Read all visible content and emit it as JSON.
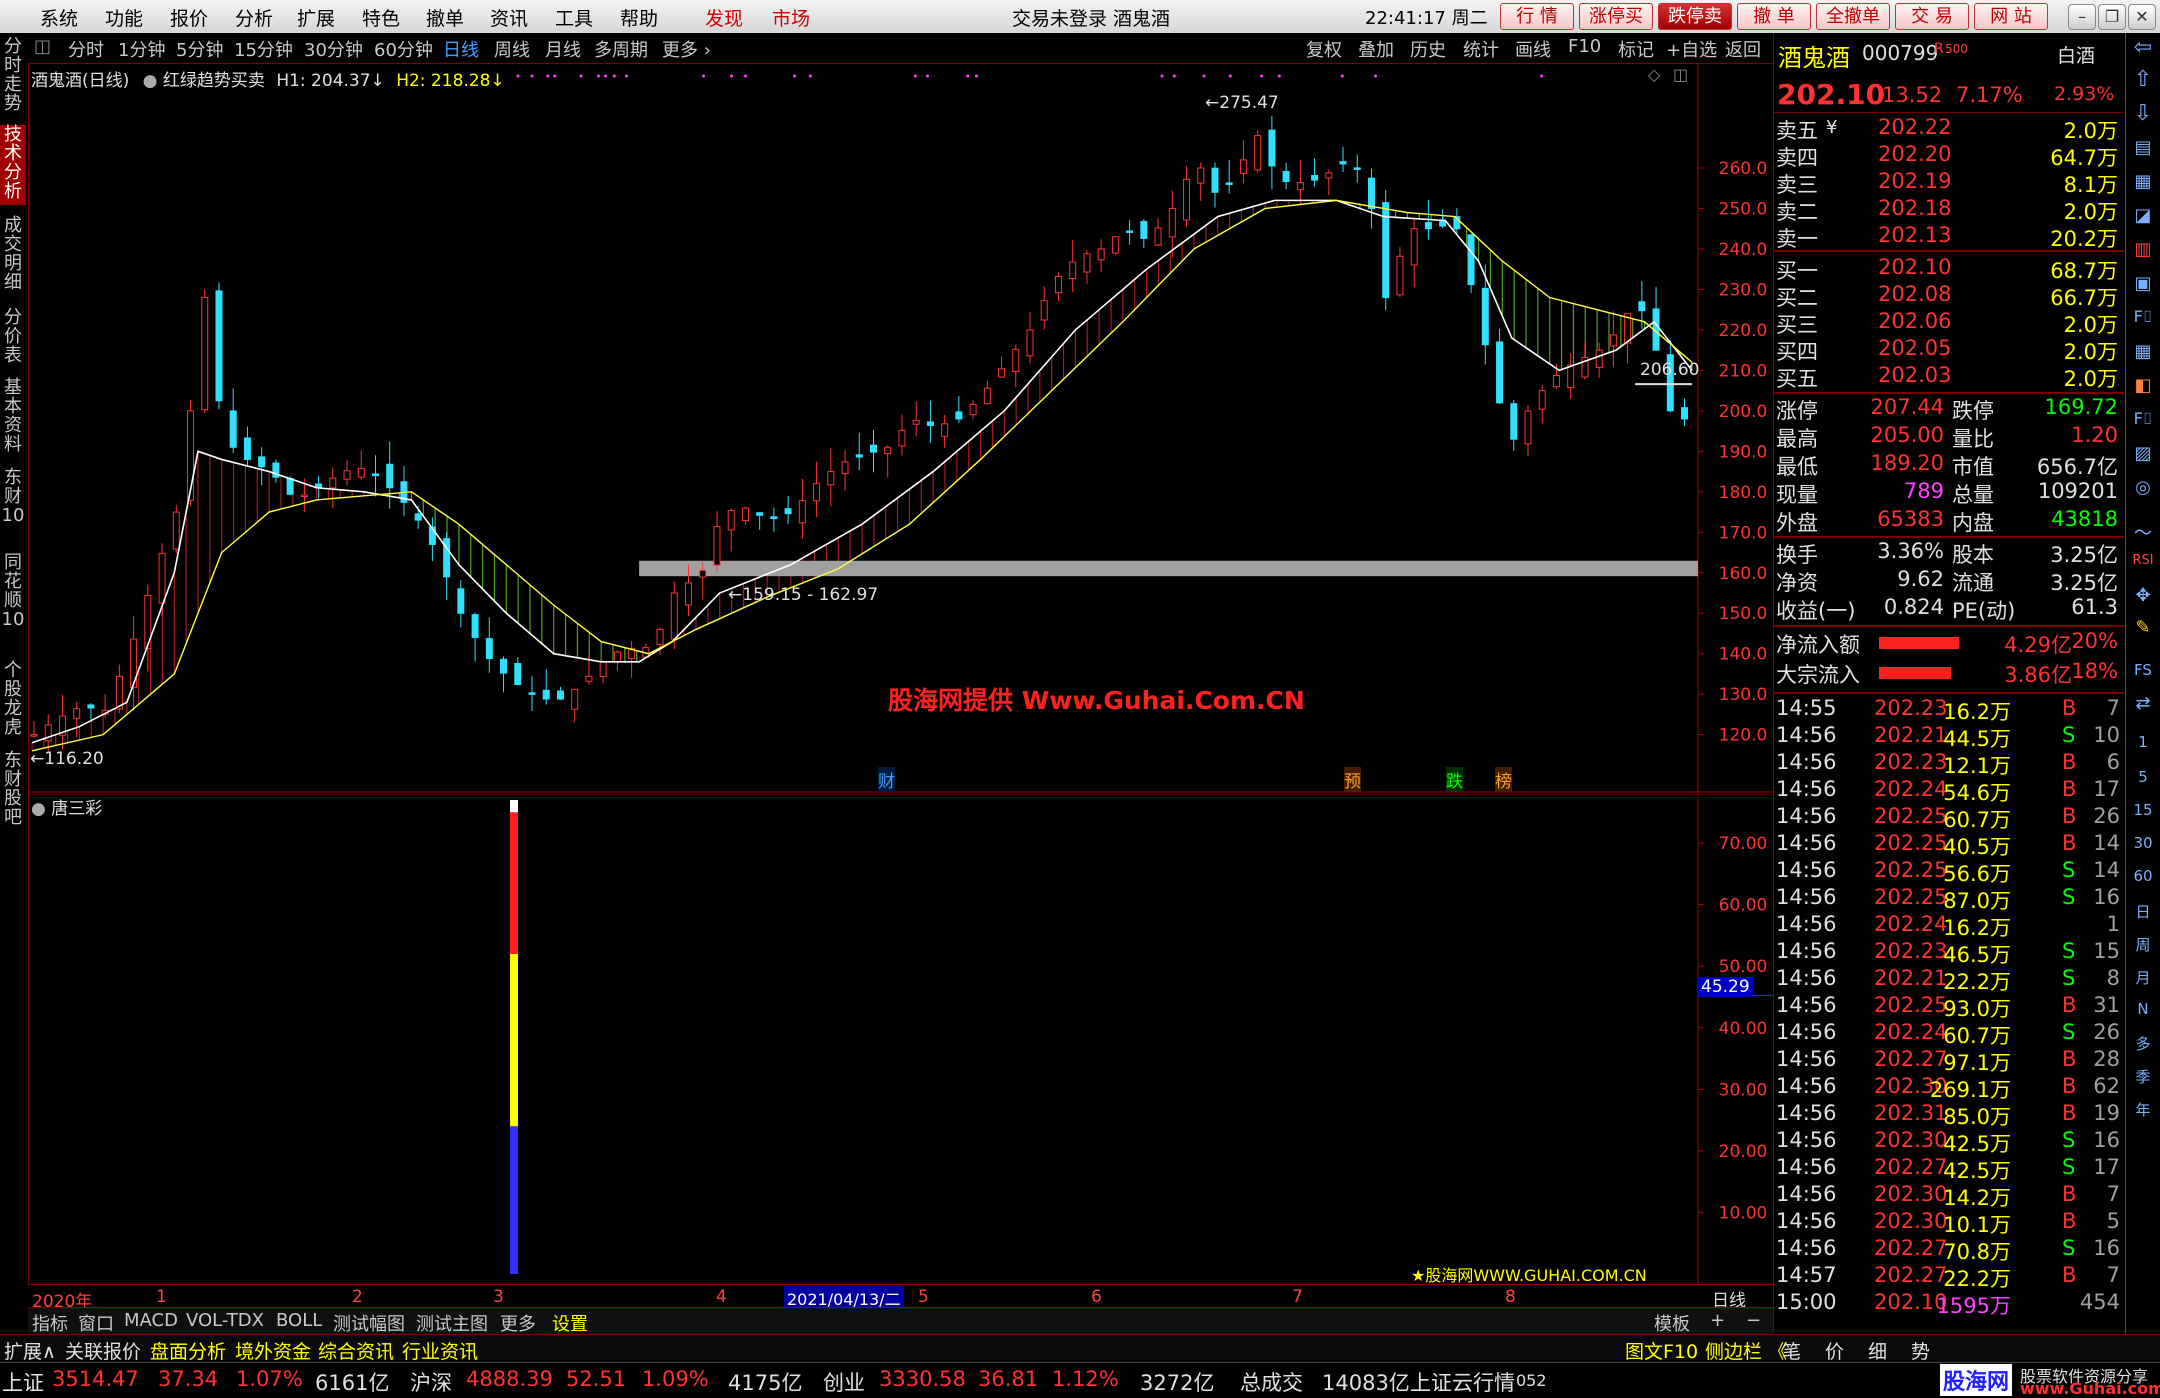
{
  "menubar": {
    "items": [
      "系统",
      "功能",
      "报价",
      "分析",
      "扩展",
      "特色",
      "撤单",
      "资讯",
      "工具",
      "帮助"
    ],
    "discover": "发现",
    "market": "市场",
    "title": "交易未登录  酒鬼酒",
    "clock": "22:41:17 周二",
    "trade_buttons": [
      "行  情",
      "涨停买",
      "跌停卖",
      "撤  单",
      "全撤单",
      "交  易",
      "网  站"
    ]
  },
  "left_tabs": [
    "分时走势",
    "技术分析",
    "成交明细",
    "分价表",
    "基本资料",
    "东财10",
    "同花顺10",
    "个股龙虎",
    "东财股吧"
  ],
  "period_bar": {
    "items": [
      "分时",
      "1分钟",
      "5分钟",
      "15分钟",
      "30分钟",
      "60分钟",
      "日线",
      "周线",
      "月线",
      "多周期",
      "更多"
    ],
    "active": "日线",
    "tools": [
      "复权",
      "叠加",
      "历史",
      "统计",
      "画线",
      "F10",
      "标记",
      "+自选",
      "返回"
    ]
  },
  "main_chart": {
    "title": "酒鬼酒(日线)",
    "indicator": "红绿趋势买卖",
    "h1_label": "H1: 204.37",
    "h2_label": "H2: 218.28",
    "hi_label": "275.47",
    "lo_label": "116.20",
    "level_label": "159.15 - 162.97",
    "last_label": "206.60",
    "watermark": "股海网提供 Www.Guhai.Com.CN",
    "markers": [
      "财",
      "预",
      "跌",
      "榜"
    ]
  },
  "sub_chart": {
    "title": "唐三彩",
    "current_value": "45.29",
    "credit": "★股海网WWW.GUHAI.COM.CN",
    "y_ticks": [
      "70.00",
      "60.00",
      "50.00",
      "40.00",
      "30.00",
      "20.00",
      "10.00"
    ]
  },
  "x_axis": {
    "labels": [
      "2020年",
      "1",
      "2",
      "3",
      "4",
      "5",
      "6",
      "7",
      "8"
    ],
    "cursor_date": "2021/04/13/二",
    "period": "日线"
  },
  "indicator_bar": {
    "items": [
      "指标",
      "窗口",
      "MACD",
      "VOL-TDX",
      "BOLL",
      "测试幅图",
      "测试主图",
      "更多",
      "设置"
    ],
    "template": "模板",
    "plus": "+",
    "minus": "−"
  },
  "extension_bar": {
    "items": [
      "扩展∧",
      "关联报价",
      "盘面分析",
      "境外资金",
      "综合资讯",
      "行业资讯"
    ],
    "right_items": [
      "图文F10",
      "侧边栏 《",
      "笔",
      "价",
      "细",
      "势"
    ]
  },
  "status_bar": {
    "sh": {
      "name": "上证",
      "index": "3514.47",
      "chg": "37.34",
      "pct": "1.07%",
      "amt": "6161亿"
    },
    "sz": {
      "name": "沪深",
      "index": "4888.39",
      "chg": "52.51",
      "pct": "1.09%",
      "amt": "4175亿"
    },
    "cy": {
      "name": "创业",
      "index": "3330.58",
      "chg": "36.81",
      "pct": "1.12%",
      "amt": "3272亿"
    },
    "total": "总成交",
    "total_amt": "14083亿",
    "cloud": "上证云行情",
    "cloud_code": "052",
    "brand": "股海网",
    "brand_sub": "股票软件资源分享",
    "brand_url": "www.Guhai.com.cn"
  },
  "quote": {
    "name": "酒鬼酒",
    "code": "000799",
    "tag": "R",
    "tag_num": "500",
    "sector": "白酒",
    "price": "202.10",
    "change": "13.52",
    "change_pct": "7.17%",
    "amp": "2.93%",
    "asks": [
      {
        "label": "卖五",
        "price": "202.22",
        "vol": "2.0万"
      },
      {
        "label": "卖四",
        "price": "202.20",
        "vol": "64.7万"
      },
      {
        "label": "卖三",
        "price": "202.19",
        "vol": "8.1万"
      },
      {
        "label": "卖二",
        "price": "202.18",
        "vol": "2.0万"
      },
      {
        "label": "卖一",
        "price": "202.13",
        "vol": "20.2万"
      }
    ],
    "ask_currency": "¥",
    "bids": [
      {
        "label": "买一",
        "price": "202.10",
        "vol": "68.7万"
      },
      {
        "label": "买二",
        "price": "202.08",
        "vol": "66.7万"
      },
      {
        "label": "买三",
        "price": "202.06",
        "vol": "2.0万"
      },
      {
        "label": "买四",
        "price": "202.05",
        "vol": "2.0万"
      },
      {
        "label": "买五",
        "price": "202.03",
        "vol": "2.0万"
      }
    ],
    "stats": [
      {
        "l1": "涨停",
        "v1": "207.44",
        "l2": "跌停",
        "v2": "169.72"
      },
      {
        "l1": "最高",
        "v1": "205.00",
        "l2": "量比",
        "v2": "1.20"
      },
      {
        "l1": "最低",
        "v1": "189.20",
        "l2": "市值",
        "v2": "656.7亿"
      },
      {
        "l1": "现量",
        "v1": "789",
        "l2": "总量",
        "v2": "109201"
      },
      {
        "l1": "外盘",
        "v1": "65383",
        "l2": "内盘",
        "v2": "43818"
      }
    ],
    "stats2": [
      {
        "l1": "换手",
        "v1": "3.36%",
        "l2": "股本",
        "v2": "3.25亿"
      },
      {
        "l1": "净资",
        "v1": "9.62",
        "l2": "流通",
        "v2": "3.25亿"
      },
      {
        "l1": "收益(一)",
        "v1": "0.824",
        "l2": "PE(动)",
        "v2": "61.3"
      }
    ],
    "flows": [
      {
        "label": "净流入额",
        "value": "4.29亿",
        "pct": "20%",
        "level": 0.2
      },
      {
        "label": "大宗流入",
        "value": "3.86亿",
        "pct": "18%",
        "level": 0.18
      }
    ],
    "ticks": [
      {
        "t": "14:55",
        "p": "202.23",
        "v": "16.2万",
        "s": "B",
        "n": "7"
      },
      {
        "t": "14:56",
        "p": "202.21",
        "v": "44.5万",
        "s": "S",
        "n": "10"
      },
      {
        "t": "14:56",
        "p": "202.23",
        "v": "12.1万",
        "s": "B",
        "n": "6"
      },
      {
        "t": "14:56",
        "p": "202.24",
        "v": "54.6万",
        "s": "B",
        "n": "17"
      },
      {
        "t": "14:56",
        "p": "202.25",
        "v": "60.7万",
        "s": "B",
        "n": "26"
      },
      {
        "t": "14:56",
        "p": "202.25",
        "v": "40.5万",
        "s": "B",
        "n": "14"
      },
      {
        "t": "14:56",
        "p": "202.25",
        "v": "56.6万",
        "s": "S",
        "n": "14"
      },
      {
        "t": "14:56",
        "p": "202.25",
        "v": "87.0万",
        "s": "S",
        "n": "16"
      },
      {
        "t": "14:56",
        "p": "202.24",
        "v": "16.2万",
        "s": "",
        "n": "1"
      },
      {
        "t": "14:56",
        "p": "202.23",
        "v": "46.5万",
        "s": "S",
        "n": "15"
      },
      {
        "t": "14:56",
        "p": "202.21",
        "v": "22.2万",
        "s": "S",
        "n": "8"
      },
      {
        "t": "14:56",
        "p": "202.25",
        "v": "93.0万",
        "s": "B",
        "n": "31"
      },
      {
        "t": "14:56",
        "p": "202.24",
        "v": "60.7万",
        "s": "S",
        "n": "26"
      },
      {
        "t": "14:56",
        "p": "202.27",
        "v": "97.1万",
        "s": "B",
        "n": "28"
      },
      {
        "t": "14:56",
        "p": "202.30",
        "v": "269.1万",
        "s": "B",
        "n": "62"
      },
      {
        "t": "14:56",
        "p": "202.31",
        "v": "85.0万",
        "s": "B",
        "n": "19"
      },
      {
        "t": "14:56",
        "p": "202.30",
        "v": "42.5万",
        "s": "S",
        "n": "16"
      },
      {
        "t": "14:56",
        "p": "202.27",
        "v": "42.5万",
        "s": "S",
        "n": "17"
      },
      {
        "t": "14:56",
        "p": "202.30",
        "v": "14.2万",
        "s": "B",
        "n": "7"
      },
      {
        "t": "14:56",
        "p": "202.30",
        "v": "10.1万",
        "s": "B",
        "n": "5"
      },
      {
        "t": "14:56",
        "p": "202.27",
        "v": "70.8万",
        "s": "S",
        "n": "16"
      },
      {
        "t": "14:57",
        "p": "202.27",
        "v": "22.2万",
        "s": "B",
        "n": "7"
      },
      {
        "t": "15:00",
        "p": "202.10",
        "v": "1595万",
        "s": "",
        "n": "454"
      }
    ]
  },
  "right_icons": [
    "1",
    "5",
    "15",
    "30",
    "60",
    "日",
    "周",
    "月",
    "N",
    "多",
    "季",
    "年"
  ],
  "chart_data": [
    {
      "type": "candlestick",
      "title": "酒鬼酒(日线)",
      "indicator": "红绿趋势买卖",
      "y_ticks": [
        120,
        130,
        140,
        150,
        160,
        170,
        180,
        190,
        200,
        210,
        220,
        230,
        240,
        250,
        260
      ],
      "ylim": [
        113,
        281
      ],
      "x_labels": [
        "2020年",
        "1",
        "2",
        "3",
        "4",
        "5",
        "6",
        "7",
        "8"
      ],
      "close_path": [
        [
          0,
          120
        ],
        [
          5,
          124
        ],
        [
          10,
          127
        ],
        [
          15,
          126
        ],
        [
          20,
          140
        ],
        [
          25,
          158
        ],
        [
          30,
          175
        ],
        [
          33,
          200
        ],
        [
          36,
          228
        ],
        [
          38,
          212
        ],
        [
          40,
          193
        ],
        [
          45,
          188
        ],
        [
          50,
          185
        ],
        [
          55,
          178
        ],
        [
          60,
          181
        ],
        [
          65,
          185
        ],
        [
          70,
          186
        ],
        [
          75,
          181
        ],
        [
          80,
          175
        ],
        [
          85,
          165
        ],
        [
          90,
          150
        ],
        [
          95,
          140
        ],
        [
          100,
          134
        ],
        [
          105,
          130
        ],
        [
          110,
          128
        ],
        [
          115,
          132
        ],
        [
          120,
          138
        ],
        [
          125,
          142
        ],
        [
          128,
          140
        ],
        [
          132,
          146
        ],
        [
          136,
          158
        ],
        [
          140,
          157
        ],
        [
          145,
          175
        ],
        [
          150,
          176
        ],
        [
          155,
          173
        ],
        [
          160,
          175
        ],
        [
          165,
          182
        ],
        [
          170,
          187
        ],
        [
          175,
          189
        ],
        [
          180,
          191
        ],
        [
          185,
          198
        ],
        [
          190,
          196
        ],
        [
          195,
          198
        ],
        [
          200,
          204
        ],
        [
          205,
          212
        ],
        [
          210,
          220
        ],
        [
          215,
          232
        ],
        [
          220,
          238
        ],
        [
          225,
          240
        ],
        [
          230,
          245
        ],
        [
          235,
          242
        ],
        [
          240,
          250
        ],
        [
          245,
          262
        ],
        [
          250,
          252
        ],
        [
          255,
          262
        ],
        [
          258,
          268
        ],
        [
          262,
          258
        ],
        [
          265,
          256
        ],
        [
          270,
          257
        ],
        [
          275,
          260
        ],
        [
          278,
          263
        ],
        [
          282,
          250
        ],
        [
          285,
          228
        ],
        [
          290,
          245
        ],
        [
          295,
          245
        ],
        [
          298,
          246
        ],
        [
          300,
          245
        ],
        [
          305,
          222
        ],
        [
          308,
          205
        ],
        [
          312,
          193
        ],
        [
          315,
          200
        ],
        [
          318,
          205
        ],
        [
          322,
          210
        ],
        [
          325,
          212
        ],
        [
          330,
          215
        ],
        [
          334,
          220
        ],
        [
          338,
          228
        ],
        [
          342,
          215
        ],
        [
          345,
          200
        ],
        [
          348,
          198
        ],
        [
          350,
          202
        ]
      ],
      "trend_path": [
        [
          0,
          118
        ],
        [
          10,
          122
        ],
        [
          20,
          128
        ],
        [
          30,
          160
        ],
        [
          35,
          190
        ],
        [
          40,
          188
        ],
        [
          50,
          185
        ],
        [
          60,
          181
        ],
        [
          70,
          180
        ],
        [
          80,
          178
        ],
        [
          90,
          162
        ],
        [
          100,
          150
        ],
        [
          110,
          140
        ],
        [
          120,
          138
        ],
        [
          128,
          138
        ],
        [
          135,
          143
        ],
        [
          145,
          155
        ],
        [
          160,
          162
        ],
        [
          175,
          172
        ],
        [
          190,
          185
        ],
        [
          205,
          200
        ],
        [
          220,
          220
        ],
        [
          235,
          235
        ],
        [
          250,
          248
        ],
        [
          262,
          252
        ],
        [
          275,
          252
        ],
        [
          285,
          248
        ],
        [
          298,
          247
        ],
        [
          305,
          237
        ],
        [
          312,
          218
        ],
        [
          322,
          210
        ],
        [
          334,
          215
        ],
        [
          342,
          222
        ],
        [
          350,
          210
        ]
      ],
      "slow_path": [
        [
          0,
          116
        ],
        [
          15,
          120
        ],
        [
          30,
          135
        ],
        [
          40,
          165
        ],
        [
          50,
          175
        ],
        [
          60,
          178
        ],
        [
          70,
          179
        ],
        [
          80,
          180
        ],
        [
          90,
          172
        ],
        [
          100,
          162
        ],
        [
          110,
          152
        ],
        [
          120,
          143
        ],
        [
          130,
          140
        ],
        [
          140,
          146
        ],
        [
          155,
          154
        ],
        [
          170,
          161
        ],
        [
          185,
          172
        ],
        [
          200,
          188
        ],
        [
          215,
          205
        ],
        [
          230,
          222
        ],
        [
          245,
          240
        ],
        [
          260,
          250
        ],
        [
          275,
          252
        ],
        [
          290,
          249
        ],
        [
          300,
          248
        ],
        [
          310,
          237
        ],
        [
          320,
          228
        ],
        [
          330,
          225
        ],
        [
          340,
          222
        ],
        [
          350,
          212
        ]
      ],
      "support_level": [
        159.15,
        162.97
      ],
      "high": 275.47,
      "low": 116.2,
      "last_marker": 206.6
    },
    {
      "type": "bar",
      "title": "唐三彩",
      "current_value": 45.29,
      "y_ticks": [
        10,
        20,
        30,
        40,
        50,
        60,
        70
      ],
      "ylim": [
        0,
        77
      ],
      "segments": [
        {
          "color": "#3030ff",
          "from": 0,
          "to": 24
        },
        {
          "color": "#ffff00",
          "from": 24,
          "to": 52
        },
        {
          "color": "#ff2020",
          "from": 52,
          "to": 75
        },
        {
          "color": "#ffffff",
          "from": 75,
          "to": 77
        }
      ]
    }
  ]
}
